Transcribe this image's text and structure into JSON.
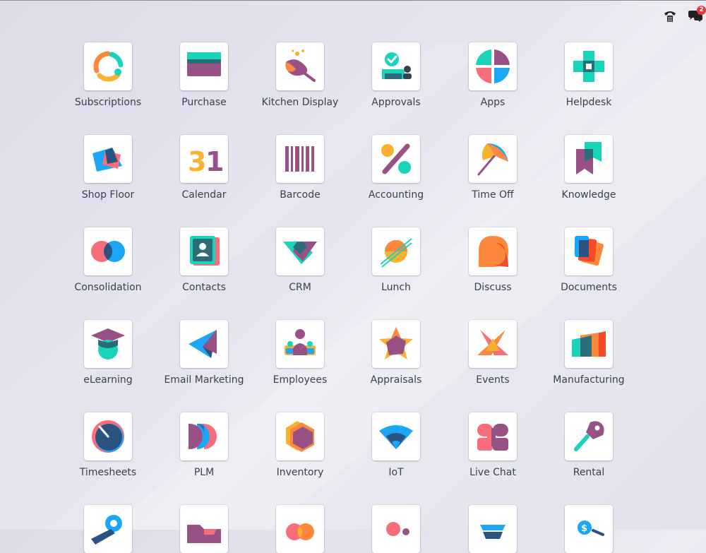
{
  "systray": {
    "phone_icon": "phone-icon",
    "chat_icon": "chat-icon",
    "chat_badge": "2"
  },
  "apps": [
    {
      "label": "Subscriptions",
      "icon": "subscriptions-icon"
    },
    {
      "label": "Purchase",
      "icon": "purchase-icon"
    },
    {
      "label": "Kitchen Display",
      "icon": "kitchen-display-icon"
    },
    {
      "label": "Approvals",
      "icon": "approvals-icon"
    },
    {
      "label": "Apps",
      "icon": "apps-icon"
    },
    {
      "label": "Helpdesk",
      "icon": "helpdesk-icon"
    },
    {
      "label": "Shop Floor",
      "icon": "shop-floor-icon"
    },
    {
      "label": "Calendar",
      "icon": "calendar-icon",
      "icon_text": "31"
    },
    {
      "label": "Barcode",
      "icon": "barcode-icon"
    },
    {
      "label": "Accounting",
      "icon": "accounting-icon"
    },
    {
      "label": "Time Off",
      "icon": "time-off-icon"
    },
    {
      "label": "Knowledge",
      "icon": "knowledge-icon"
    },
    {
      "label": "Consolidation",
      "icon": "consolidation-icon"
    },
    {
      "label": "Contacts",
      "icon": "contacts-icon"
    },
    {
      "label": "CRM",
      "icon": "crm-icon"
    },
    {
      "label": "Lunch",
      "icon": "lunch-icon"
    },
    {
      "label": "Discuss",
      "icon": "discuss-icon"
    },
    {
      "label": "Documents",
      "icon": "documents-icon"
    },
    {
      "label": "eLearning",
      "icon": "elearning-icon"
    },
    {
      "label": "Email Marketing",
      "icon": "email-marketing-icon"
    },
    {
      "label": "Employees",
      "icon": "employees-icon"
    },
    {
      "label": "Appraisals",
      "icon": "appraisals-icon"
    },
    {
      "label": "Events",
      "icon": "events-icon"
    },
    {
      "label": "Manufacturing",
      "icon": "manufacturing-icon"
    },
    {
      "label": "Timesheets",
      "icon": "timesheets-icon"
    },
    {
      "label": "PLM",
      "icon": "plm-icon"
    },
    {
      "label": "Inventory",
      "icon": "inventory-icon"
    },
    {
      "label": "IoT",
      "icon": "iot-icon"
    },
    {
      "label": "Live Chat",
      "icon": "live-chat-icon"
    },
    {
      "label": "Rental",
      "icon": "rental-icon"
    },
    {
      "label": "",
      "icon": "map-pin-icon"
    },
    {
      "label": "",
      "icon": "folder-arrow-icon"
    },
    {
      "label": "",
      "icon": "heart-icon"
    },
    {
      "label": "",
      "icon": "people-dots-icon"
    },
    {
      "label": "",
      "icon": "stack-icon"
    },
    {
      "label": "",
      "icon": "coin-icon"
    }
  ],
  "colors": {
    "teal": "#1ad3bb",
    "purple": "#985184",
    "orange": "#fc883e",
    "yellow": "#fbb130",
    "blue": "#1ba6f7",
    "pink": "#f86d7a",
    "dark_blue": "#2c5282",
    "badge_red": "#e0393e"
  }
}
